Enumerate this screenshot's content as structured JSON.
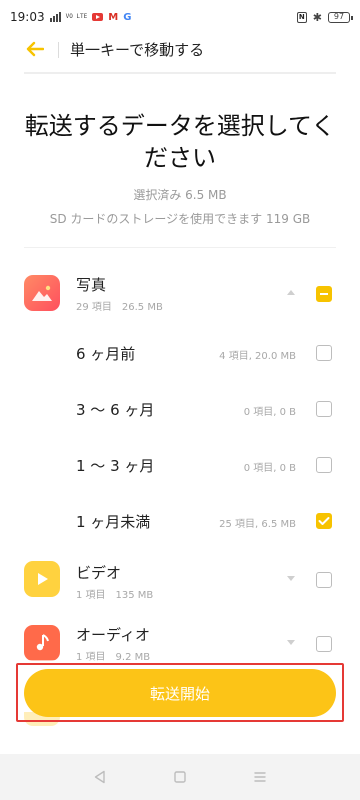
{
  "status_bar": {
    "time": "19:03",
    "signal_label": "VO LTE",
    "battery": "97",
    "icons": [
      "signal-icon",
      "youtube-icon",
      "gmail-icon",
      "google-icon",
      "nfc-icon",
      "bluetooth-icon",
      "battery-icon"
    ],
    "gmail_glyph": "M",
    "google_glyph": "G",
    "nfc_glyph": "N",
    "bluetooth_glyph": "✱"
  },
  "header": {
    "title": "単一キーで移動する",
    "back_icon": "arrow-left-icon"
  },
  "page": {
    "title": "転送するデータを選択してください",
    "selected_summary": "選択済み 6.5 MB",
    "storage_summary": "SD カードのストレージを使用できます 119 GB"
  },
  "categories": [
    {
      "title": "写真",
      "meta": "29 項目　26.5 MB",
      "icon": "photos-icon",
      "expanded": true,
      "check_state": "partial",
      "subitems": [
        {
          "label": "6 ヶ月前",
          "meta": "4 項目, 20.0 MB",
          "checked": false
        },
        {
          "label": "3 〜 6 ヶ月",
          "meta": "0 項目, 0 B",
          "checked": false
        },
        {
          "label": "1 〜 3 ヶ月",
          "meta": "0 項目, 0 B",
          "checked": false
        },
        {
          "label": "1 ヶ月未満",
          "meta": "25 項目, 6.5 MB",
          "checked": true
        }
      ]
    },
    {
      "title": "ビデオ",
      "meta": "1 項目　135 MB",
      "icon": "video-icon",
      "expanded": false,
      "check_state": "unchecked"
    },
    {
      "title": "オーディオ",
      "meta": "1 項目　9.2 MB",
      "icon": "audio-icon",
      "expanded": false,
      "check_state": "unchecked"
    }
  ],
  "actions": {
    "start_transfer": "転送開始"
  },
  "colors": {
    "accent": "#fcc417",
    "highlight": "#e53935"
  },
  "nav_bar": {
    "icons": [
      "back-triangle-icon",
      "home-square-icon",
      "menu-lines-icon"
    ]
  }
}
